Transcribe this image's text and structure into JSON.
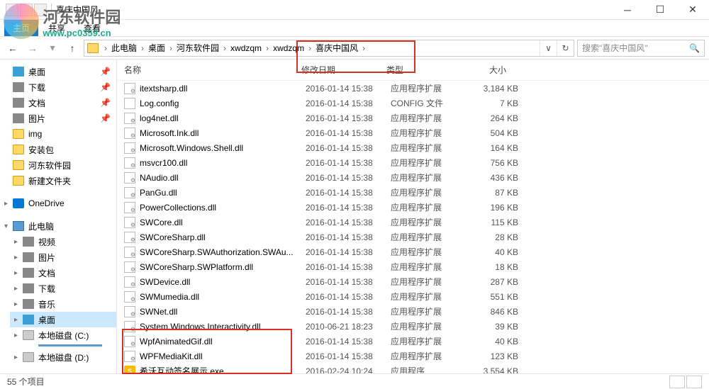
{
  "watermark": {
    "title": "河东软件园",
    "url": "www.pc0359.cn"
  },
  "window_title": "喜庆中国风",
  "ribbon": {
    "file": "主页",
    "share": "共享",
    "view": "查看"
  },
  "breadcrumbs": [
    "此电脑",
    "桌面",
    "河东软件园",
    "xwdzqm",
    "xwdzqm",
    "喜庆中国风"
  ],
  "search_placeholder": "搜索\"喜庆中国风\"",
  "columns": {
    "name": "名称",
    "date": "修改日期",
    "type": "类型",
    "size": "大小"
  },
  "sidebar": {
    "quick": [
      {
        "label": "桌面",
        "icon": "desktop-ico",
        "pin": true
      },
      {
        "label": "下载",
        "icon": "generic-ico",
        "pin": true
      },
      {
        "label": "文档",
        "icon": "generic-ico",
        "pin": true
      },
      {
        "label": "图片",
        "icon": "generic-ico",
        "pin": true
      },
      {
        "label": "img",
        "icon": "folder-ico"
      },
      {
        "label": "安装包",
        "icon": "folder-ico"
      },
      {
        "label": "河东软件园",
        "icon": "folder-ico"
      },
      {
        "label": "新建文件夹",
        "icon": "folder-ico"
      }
    ],
    "onedrive": "OneDrive",
    "thispc": {
      "label": "此电脑",
      "items": [
        {
          "label": "视频",
          "icon": "generic-ico"
        },
        {
          "label": "图片",
          "icon": "generic-ico"
        },
        {
          "label": "文档",
          "icon": "generic-ico"
        },
        {
          "label": "下载",
          "icon": "generic-ico"
        },
        {
          "label": "音乐",
          "icon": "generic-ico"
        },
        {
          "label": "桌面",
          "icon": "desktop-ico",
          "selected": true
        },
        {
          "label": "本地磁盘 (C:)",
          "icon": "drive-ico",
          "drive": true
        },
        {
          "label": "本地磁盘 (D:)",
          "icon": "drive-ico"
        }
      ]
    }
  },
  "files": [
    {
      "name": "itextsharp.dll",
      "date": "2016-01-14 15:38",
      "type": "应用程序扩展",
      "size": "3,184 KB",
      "icon": "dll"
    },
    {
      "name": "Log.config",
      "date": "2016-01-14 15:38",
      "type": "CONFIG 文件",
      "size": "7 KB",
      "icon": "config"
    },
    {
      "name": "log4net.dll",
      "date": "2016-01-14 15:38",
      "type": "应用程序扩展",
      "size": "264 KB",
      "icon": "dll"
    },
    {
      "name": "Microsoft.Ink.dll",
      "date": "2016-01-14 15:38",
      "type": "应用程序扩展",
      "size": "504 KB",
      "icon": "dll"
    },
    {
      "name": "Microsoft.Windows.Shell.dll",
      "date": "2016-01-14 15:38",
      "type": "应用程序扩展",
      "size": "164 KB",
      "icon": "dll"
    },
    {
      "name": "msvcr100.dll",
      "date": "2016-01-14 15:38",
      "type": "应用程序扩展",
      "size": "756 KB",
      "icon": "dll"
    },
    {
      "name": "NAudio.dll",
      "date": "2016-01-14 15:38",
      "type": "应用程序扩展",
      "size": "436 KB",
      "icon": "dll"
    },
    {
      "name": "PanGu.dll",
      "date": "2016-01-14 15:38",
      "type": "应用程序扩展",
      "size": "87 KB",
      "icon": "dll"
    },
    {
      "name": "PowerCollections.dll",
      "date": "2016-01-14 15:38",
      "type": "应用程序扩展",
      "size": "196 KB",
      "icon": "dll"
    },
    {
      "name": "SWCore.dll",
      "date": "2016-01-14 15:38",
      "type": "应用程序扩展",
      "size": "115 KB",
      "icon": "dll"
    },
    {
      "name": "SWCoreSharp.dll",
      "date": "2016-01-14 15:38",
      "type": "应用程序扩展",
      "size": "28 KB",
      "icon": "dll"
    },
    {
      "name": "SWCoreSharp.SWAuthorization.SWAu...",
      "date": "2016-01-14 15:38",
      "type": "应用程序扩展",
      "size": "40 KB",
      "icon": "dll"
    },
    {
      "name": "SWCoreSharp.SWPlatform.dll",
      "date": "2016-01-14 15:38",
      "type": "应用程序扩展",
      "size": "18 KB",
      "icon": "dll"
    },
    {
      "name": "SWDevice.dll",
      "date": "2016-01-14 15:38",
      "type": "应用程序扩展",
      "size": "287 KB",
      "icon": "dll"
    },
    {
      "name": "SWMumedia.dll",
      "date": "2016-01-14 15:38",
      "type": "应用程序扩展",
      "size": "551 KB",
      "icon": "dll"
    },
    {
      "name": "SWNet.dll",
      "date": "2016-01-14 15:38",
      "type": "应用程序扩展",
      "size": "846 KB",
      "icon": "dll"
    },
    {
      "name": "System.Windows.Interactivity.dll",
      "date": "2010-06-21 18:23",
      "type": "应用程序扩展",
      "size": "39 KB",
      "icon": "dll"
    },
    {
      "name": "WpfAnimatedGif.dll",
      "date": "2016-01-14 15:38",
      "type": "应用程序扩展",
      "size": "40 KB",
      "icon": "dll"
    },
    {
      "name": "WPFMediaKit.dll",
      "date": "2016-01-14 15:38",
      "type": "应用程序扩展",
      "size": "123 KB",
      "icon": "dll"
    },
    {
      "name": "希沃互动签名展示.exe",
      "date": "2016-02-24 10:24",
      "type": "应用程序",
      "size": "3,554 KB",
      "icon": "exe"
    }
  ],
  "status": "55 个项目"
}
